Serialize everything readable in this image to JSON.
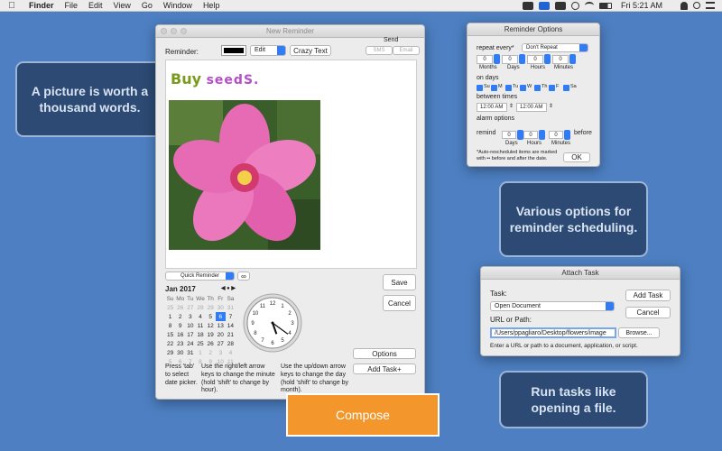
{
  "menubar": {
    "app": "Finder",
    "items": [
      "File",
      "Edit",
      "View",
      "Go",
      "Window",
      "Help"
    ],
    "clock": "Fri 5:21 AM"
  },
  "callouts": {
    "picture": "A picture is worth a thousand words.",
    "options": "Various options for reminder scheduling.",
    "tasks": "Run tasks like opening a file."
  },
  "new_reminder": {
    "title": "New Reminder",
    "reminder_label": "Reminder:",
    "edit_label": "Edit",
    "crazy_text_label": "Crazy Text",
    "send_label": "Send",
    "sms_label": "SMS",
    "email_label": "Email",
    "note_text_1": "Buy ",
    "note_text_2": "seedS.",
    "quick_reminder": "Quick Reminder",
    "infinity": "∞",
    "save_label": "Save",
    "cancel_label": "Cancel",
    "options_label": "Options",
    "add_task_label": "Add Task+",
    "calendar": {
      "month": "Jan 2017",
      "weekdays": [
        "Su",
        "Mo",
        "Tu",
        "We",
        "Th",
        "Fr",
        "Sa"
      ],
      "weeks": [
        [
          "25",
          "26",
          "27",
          "28",
          "29",
          "30",
          "31"
        ],
        [
          "1",
          "2",
          "3",
          "4",
          "5",
          "6",
          "7"
        ],
        [
          "8",
          "9",
          "10",
          "11",
          "12",
          "13",
          "14"
        ],
        [
          "15",
          "16",
          "17",
          "18",
          "19",
          "20",
          "21"
        ],
        [
          "22",
          "23",
          "24",
          "25",
          "26",
          "27",
          "28"
        ],
        [
          "29",
          "30",
          "31",
          "1",
          "2",
          "3",
          "4"
        ],
        [
          "5",
          "6",
          "7",
          "8",
          "9",
          "10",
          "11"
        ]
      ],
      "selected": "6"
    },
    "help_1": "Press 'tab' to select date picker.",
    "help_2": "Use the right/left arrow keys to change the minute (hold 'shift' to change by hour).",
    "help_3": "Use the up/down arrow keys to change the day (hold 'shift' to change by month).",
    "clock_time": "5:21"
  },
  "compose_label": "Compose",
  "reminder_options": {
    "title": "Reminder Options",
    "repeat_label": "repeat every*",
    "repeat_value": "Don't Repeat",
    "zero": "0",
    "months": "Months",
    "days": "Days",
    "hours": "Hours",
    "minutes": "Minutes",
    "on_days": "on days",
    "day_names": [
      "Su",
      "M",
      "Tu",
      "W",
      "Th",
      "F",
      "Sa"
    ],
    "between_times": "between times",
    "time_start": "12:00 AM",
    "time_end": "12:00 AM",
    "alarm_options": "alarm options",
    "remind": "remind",
    "before": "before",
    "footnote": "*Auto-rescheduled items are marked with •• before and after the date.",
    "ok_label": "OK"
  },
  "attach_task": {
    "title": "Attach Task",
    "task_label": "Task:",
    "task_value": "Open Document",
    "add_task_label": "Add Task",
    "cancel_label": "Cancel",
    "url_label": "URL or Path:",
    "url_value": "/Users/ppagliaro/Desktop/flowers/image",
    "browse_label": "Browse...",
    "hint": "Enter a URL or path to a document, application, or script."
  },
  "colors": {
    "desktop": "#4d7fc2",
    "accent": "#2f7cf6",
    "compose": "#f3972c",
    "callout": "#2c4a74"
  }
}
